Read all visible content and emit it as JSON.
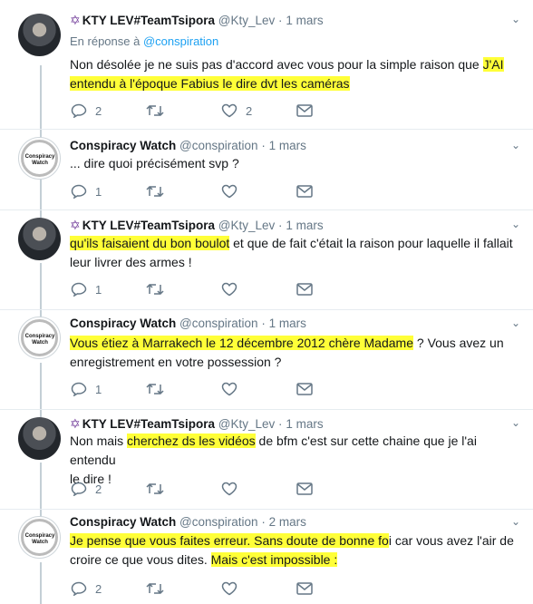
{
  "accounts": {
    "kty": {
      "name": "KTY LEV#TeamTsipora",
      "handle": "@Kty_Lev",
      "star": "✡"
    },
    "cw": {
      "name": "Conspiracy Watch",
      "handle": "@conspiration",
      "logo_text": "Conspiracy Watch"
    }
  },
  "dot": "·",
  "tweets": [
    {
      "time": "1 mars",
      "reply_prefix": "En réponse à",
      "reply_link": "@conspiration",
      "text_parts": [
        "Non désolée je ne suis pas d'accord avec vous pour la simple raison que ",
        "J'AI",
        "entendu à l'époque Fabius le dire dvt les caméras"
      ],
      "reply_count": "2",
      "retweet_count": "",
      "like_count": "2"
    },
    {
      "time": "1 mars",
      "text_parts": [
        "... dire quoi précisément svp ?"
      ],
      "reply_count": "1",
      "retweet_count": "",
      "like_count": ""
    },
    {
      "time": "1 mars",
      "text_parts": [
        "qu'ils faisaient du bon boulot",
        " et que de fait c'était la raison pour laquelle il fallait",
        "leur livrer des armes !"
      ],
      "reply_count": "1",
      "retweet_count": "",
      "like_count": ""
    },
    {
      "time": "1 mars",
      "text_parts": [
        "Vous étiez à Marrakech le 12 décembre 2012 chère Madame",
        " ? Vous avez un",
        "enregistrement en votre possession ?"
      ],
      "reply_count": "1",
      "retweet_count": "",
      "like_count": ""
    },
    {
      "time": "1 mars",
      "text_parts": [
        "Non mais ",
        "cherchez ds les vidéos",
        " de bfm c'est sur cette chaine que je l'ai entendu",
        "le dire !"
      ],
      "reply_count": "2",
      "retweet_count": "",
      "like_count": ""
    },
    {
      "time": "2 mars",
      "text_parts": [
        "Je pense que vous faites erreur. Sans doute de bonne fo",
        "i car vous avez l'air de",
        "croire ce que vous dites. ",
        "Mais c'est impossible :"
      ],
      "reply_count": "2",
      "retweet_count": "",
      "like_count": ""
    }
  ]
}
